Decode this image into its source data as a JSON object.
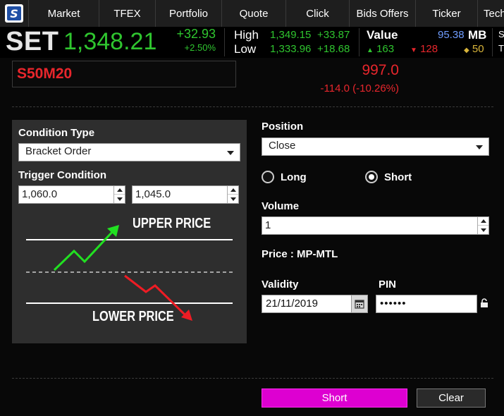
{
  "nav": {
    "items": [
      "Market",
      "TFEX",
      "Portfolio",
      "Quote",
      "Click",
      "Bids Offers",
      "Ticker",
      "Tech"
    ]
  },
  "ticker": {
    "index_name": "SET",
    "index_value": "1,348.21",
    "change": "+32.93",
    "change_pct": "+2.50%",
    "high_label": "High",
    "high_value": "1,349.15",
    "high_change": "+33.87",
    "low_label": "Low",
    "low_value": "1,333.96",
    "low_change": "+18.68",
    "value_label": "Value",
    "value_amount": "95.38",
    "value_unit": "MB",
    "up_count": "163",
    "down_count": "128",
    "unchanged_count": "50",
    "edge_letter_top": "S",
    "edge_letter_bottom": "T"
  },
  "symbol": {
    "name": "S50M20",
    "last_price": "997.0",
    "price_change": "-114.0 (-10.26%)"
  },
  "condition": {
    "type_label": "Condition Type",
    "type_value": "Bracket Order",
    "trigger_label": "Trigger Condition",
    "upper_value": "1,060.0",
    "lower_value": "1,045.0",
    "upper_price_label": "UPPER PRICE",
    "lower_price_label": "LOWER PRICE"
  },
  "order": {
    "position_label": "Position",
    "position_value": "Close",
    "side_long": "Long",
    "side_short": "Short",
    "selected_side": "Short",
    "volume_label": "Volume",
    "volume_value": "1",
    "price_text": "Price : MP-MTL",
    "validity_label": "Validity",
    "validity_value": "21/11/2019",
    "pin_label": "PIN",
    "pin_value": "••••••",
    "submit_label": "Short",
    "clear_label": "Clear"
  },
  "colors": {
    "up": "#2fc52f",
    "down": "#e8262c",
    "unchanged": "#d8b43a",
    "value": "#6f9dff",
    "accent_button": "#dd00d1"
  }
}
